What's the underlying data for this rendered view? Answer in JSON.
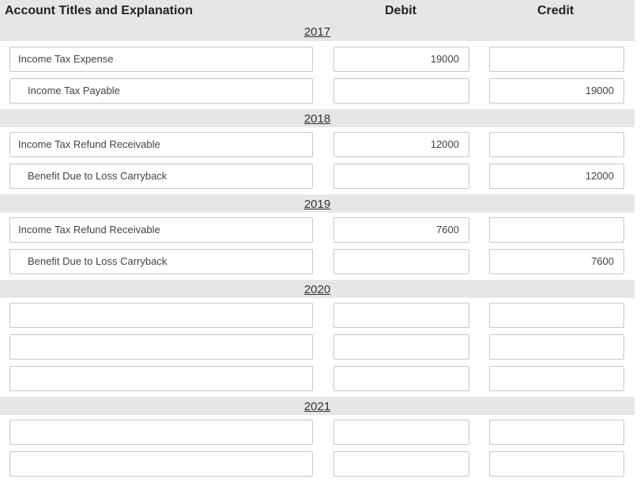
{
  "header": {
    "account": "Account Titles and Explanation",
    "debit": "Debit",
    "credit": "Credit"
  },
  "sections": [
    {
      "year": "2017",
      "rows": [
        {
          "account": "Income Tax Expense",
          "indent": false,
          "debit": "19000",
          "credit": ""
        },
        {
          "account": "Income Tax Payable",
          "indent": true,
          "debit": "",
          "credit": "19000"
        }
      ]
    },
    {
      "year": "2018",
      "rows": [
        {
          "account": "Income Tax Refund Receivable",
          "indent": false,
          "debit": "12000",
          "credit": ""
        },
        {
          "account": "Benefit Due to Loss Carryback",
          "indent": true,
          "debit": "",
          "credit": "12000"
        }
      ]
    },
    {
      "year": "2019",
      "rows": [
        {
          "account": "Income Tax Refund Receivable",
          "indent": false,
          "debit": "7600",
          "credit": ""
        },
        {
          "account": "Benefit Due to Loss Carryback",
          "indent": true,
          "debit": "",
          "credit": "7600"
        }
      ]
    },
    {
      "year": "2020",
      "rows": [
        {
          "account": "",
          "indent": false,
          "debit": "",
          "credit": ""
        },
        {
          "account": "",
          "indent": false,
          "debit": "",
          "credit": ""
        },
        {
          "account": "",
          "indent": false,
          "debit": "",
          "credit": ""
        }
      ]
    },
    {
      "year": "2021",
      "rows": [
        {
          "account": "",
          "indent": false,
          "debit": "",
          "credit": ""
        },
        {
          "account": "",
          "indent": false,
          "debit": "",
          "credit": ""
        }
      ]
    }
  ]
}
